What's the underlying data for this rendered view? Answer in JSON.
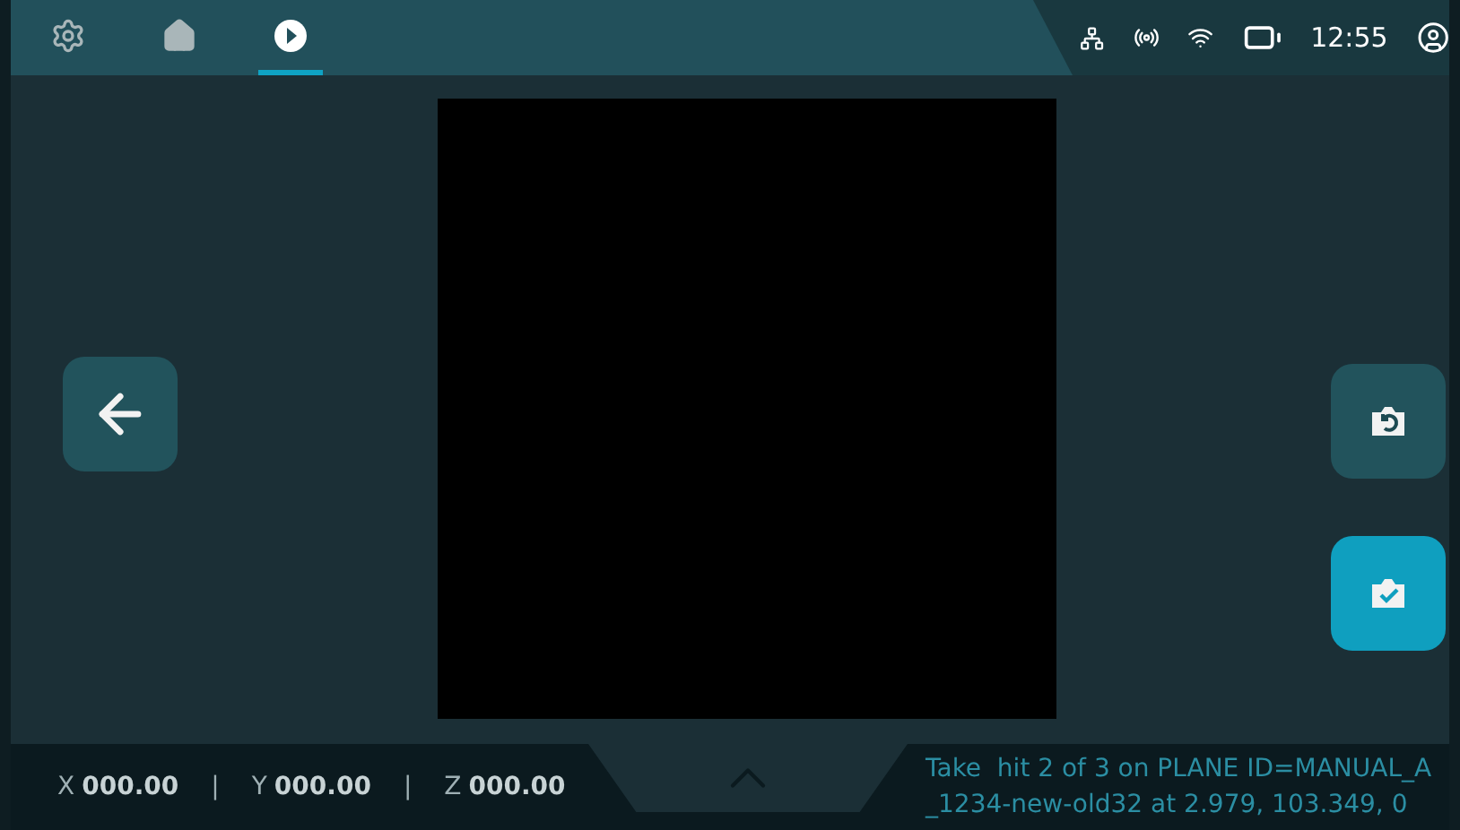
{
  "tabs": [
    {
      "kind": "settings",
      "selected": false
    },
    {
      "kind": "home",
      "selected": false
    },
    {
      "kind": "play",
      "selected": true
    }
  ],
  "status_bar": {
    "time": "12:55"
  },
  "side_buttons": [
    {
      "kind": "back",
      "selected": false
    },
    {
      "kind": "retake",
      "selected": false
    },
    {
      "kind": "accept",
      "selected": true
    }
  ],
  "coordinates": [
    {
      "axis": "X",
      "value": "000.00"
    },
    {
      "axis": "Y",
      "value": "000.00"
    },
    {
      "axis": "Z",
      "value": "000.00"
    }
  ],
  "separator": "|",
  "message": "Take  hit 2 of 3 on PLANE ID=MANUAL_A_1234-new-old32 at 2.979, 103.349, 0"
}
